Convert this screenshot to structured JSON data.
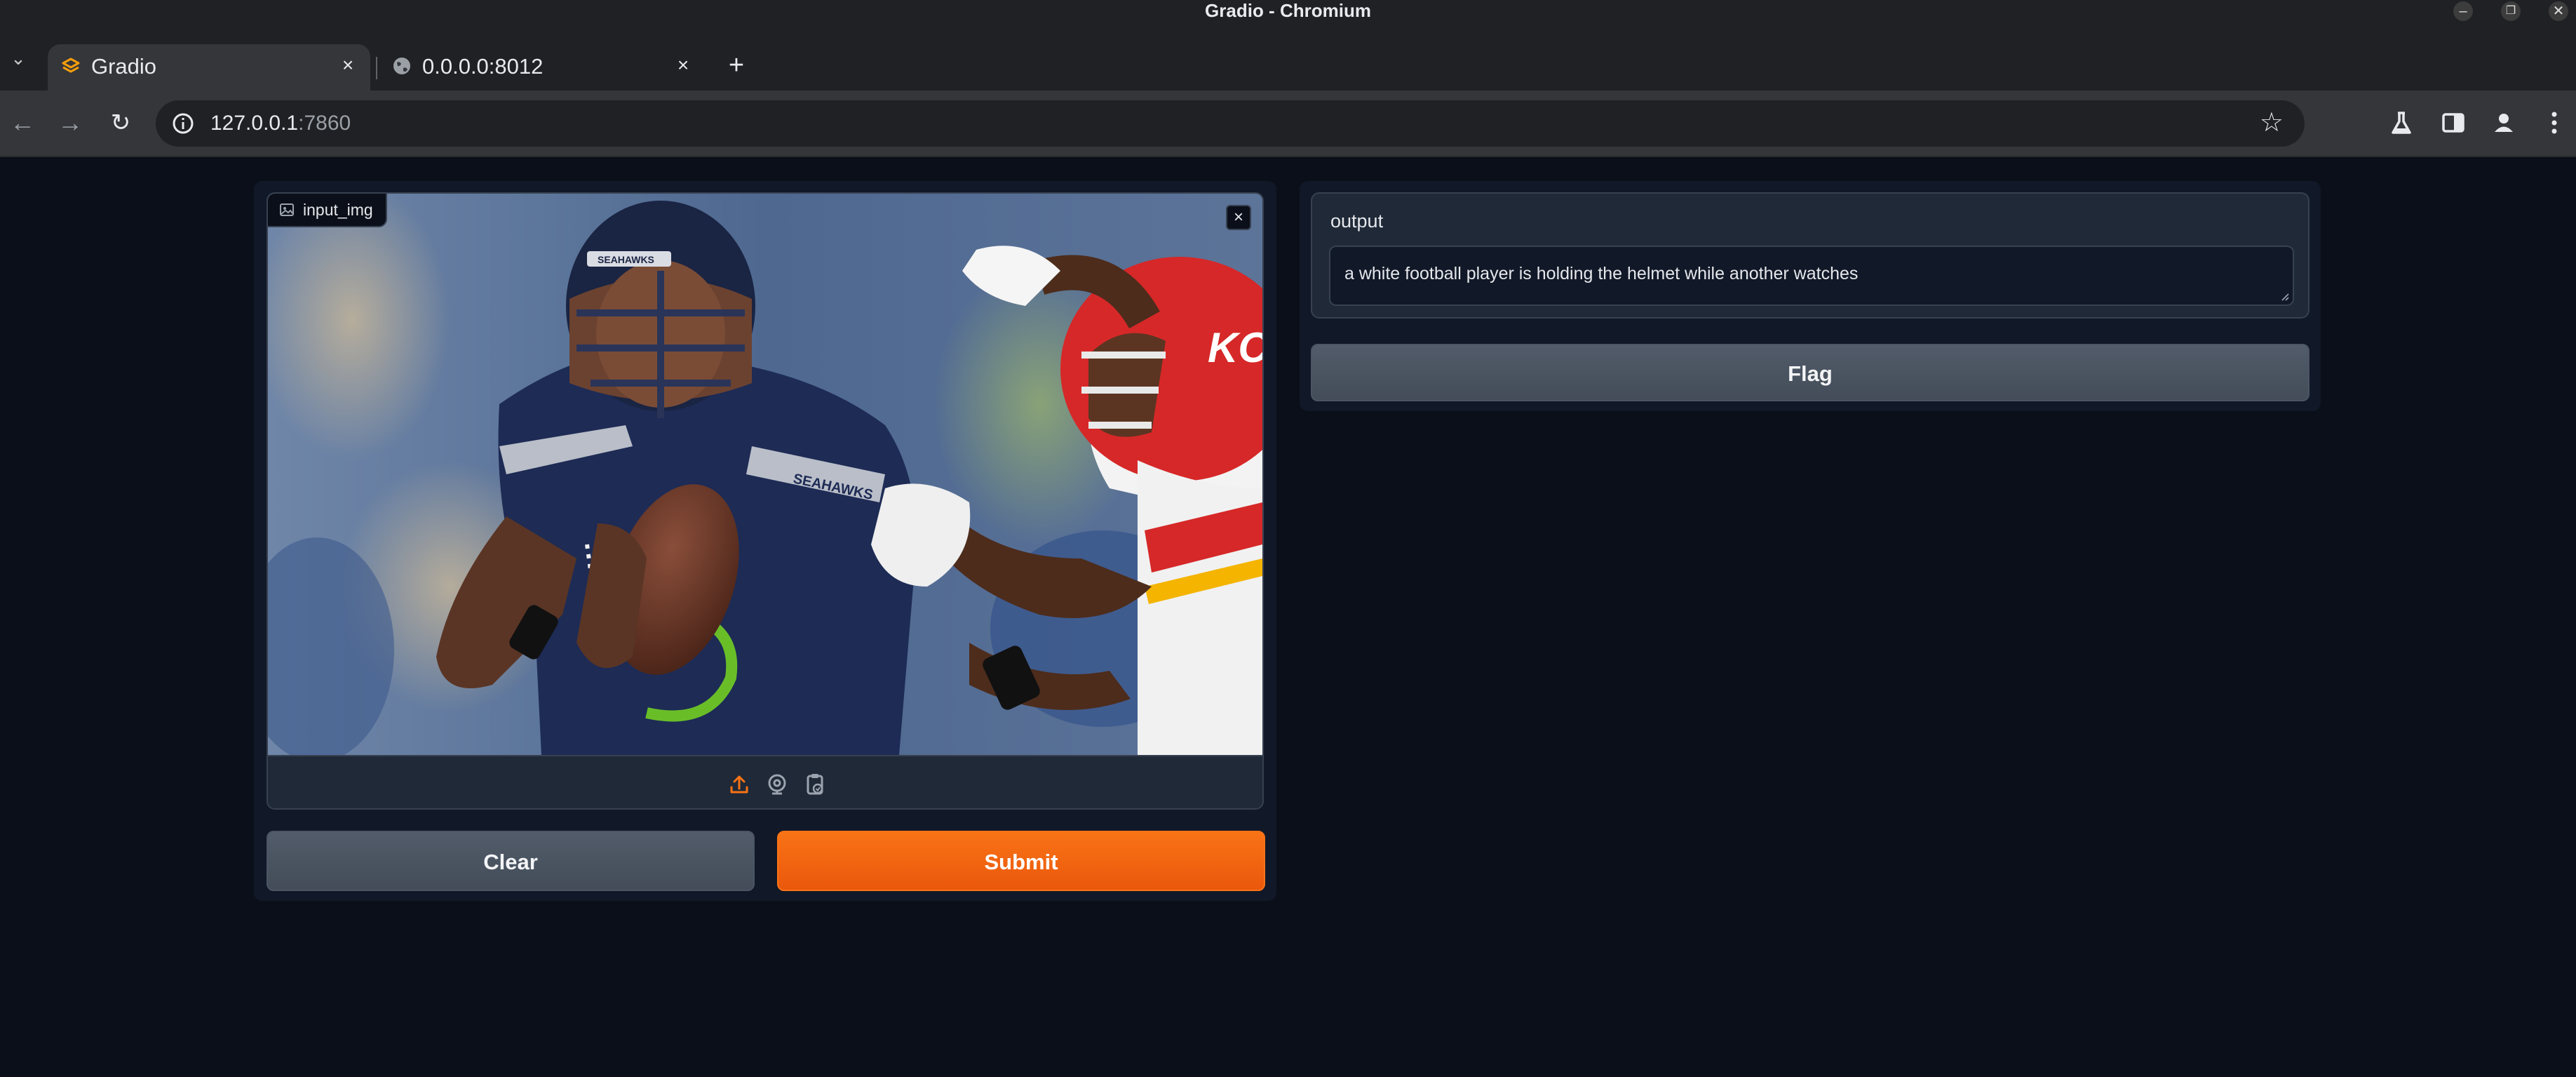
{
  "window": {
    "title": "Gradio - Chromium"
  },
  "tabs": [
    {
      "label": "Gradio",
      "active": true
    },
    {
      "label": "0.0.0.0:8012",
      "active": false
    }
  ],
  "address_bar": {
    "host": "127.0.0.1",
    "port": ":7860"
  },
  "input_image": {
    "label": "input_img"
  },
  "buttons": {
    "clear": "Clear",
    "submit": "Submit",
    "flag": "Flag"
  },
  "output": {
    "label": "output",
    "value": "a white football player is holding the helmet while another watches"
  },
  "colors": {
    "page_bg": "#0b0f19",
    "panel_bg": "#111827",
    "block_bg": "#1f2937",
    "accent_orange": "#f97316",
    "secondary_button": "#4b5563"
  },
  "icons": [
    "back-arrow-icon",
    "forward-arrow-icon",
    "reload-icon",
    "info-icon",
    "bookmark-star-icon",
    "labs-flask-icon",
    "side-panel-icon",
    "profile-icon",
    "menu-dots-icon",
    "upload-icon",
    "webcam-icon",
    "clipboard-icon",
    "close-icon",
    "image-icon"
  ]
}
